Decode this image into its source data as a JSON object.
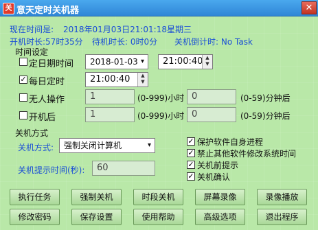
{
  "window": {
    "title": "意天定时关机器",
    "close_glyph": "✕",
    "icon_glyph": "关"
  },
  "status": {
    "current_time_label": "现在时间是:",
    "current_time_value": "2018年01月03日21:01:18星期三",
    "uptime": "开机时长:57时35分",
    "standby": "待机时长: 0时0分",
    "countdown": "关机倒计时: No Task"
  },
  "time_settings": {
    "group_label": "时间设定",
    "fixed_date": {
      "label": "定日期时间",
      "checked": false,
      "date": "2018-01-03",
      "time": "21:00:40"
    },
    "daily": {
      "label": "每日定时",
      "checked": true,
      "time": "21:00:40"
    },
    "idle": {
      "label": "无人操作",
      "checked": false,
      "hours": "1",
      "hours_hint": "(0-999)小时",
      "minutes": "0",
      "minutes_hint": "(0-59)分钟后"
    },
    "after_boot": {
      "label": "开机后",
      "checked": false,
      "hours": "1",
      "hours_hint": "(0-999)小时",
      "minutes": "0",
      "minutes_hint": "(0-59)分钟后"
    }
  },
  "shutdown": {
    "group_label": "关机方式",
    "mode_label": "关机方式:",
    "mode_value": "强制关闭计算机",
    "prompt_label": "关机提示时间(秒):",
    "prompt_value": "60"
  },
  "options": [
    {
      "label": "保护软件自身进程",
      "checked": true
    },
    {
      "label": "禁止其他软件修改系统时间",
      "checked": true
    },
    {
      "label": "关机前提示",
      "checked": true
    },
    {
      "label": "关机确认",
      "checked": true
    }
  ],
  "buttons_row1": [
    "执行任务",
    "强制关机",
    "时段关机",
    "屏幕录像",
    "录像播放"
  ],
  "buttons_row2": [
    "修改密码",
    "保存设置",
    "使用帮助",
    "高级选项",
    "退出程序"
  ],
  "glyphs": {
    "check": "✓",
    "down": "▾",
    "up_small": "▲",
    "down_small": "▼"
  }
}
